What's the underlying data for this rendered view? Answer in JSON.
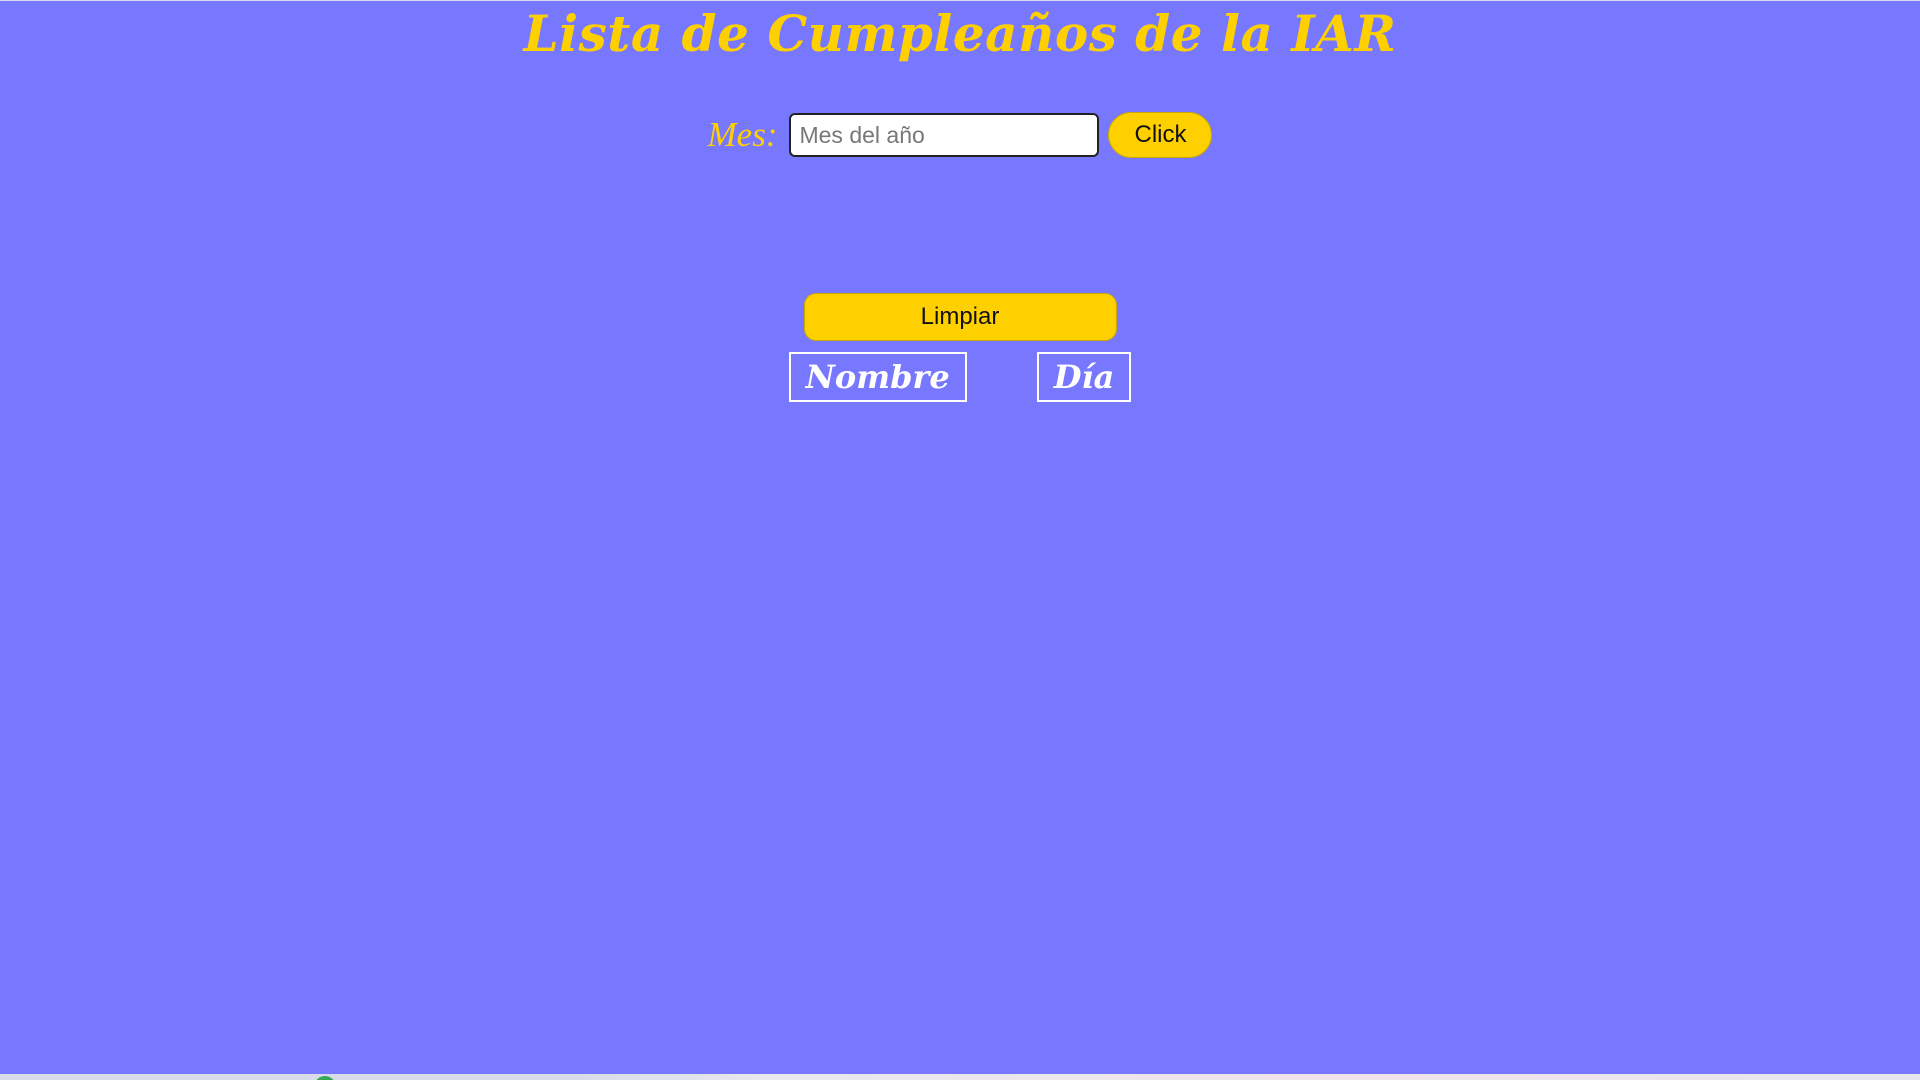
{
  "page": {
    "title": "Lista de Cumpleaños de la IAR",
    "background_color": "#7878ff",
    "accent_color": "#ffd000"
  },
  "month_form": {
    "label": "Mes:",
    "input_placeholder": "Mes del año",
    "input_value": "",
    "submit_label": "Click"
  },
  "clear_button": {
    "label": "Limpiar"
  },
  "table": {
    "columns": [
      "Nombre",
      "Día"
    ],
    "rows": []
  }
}
